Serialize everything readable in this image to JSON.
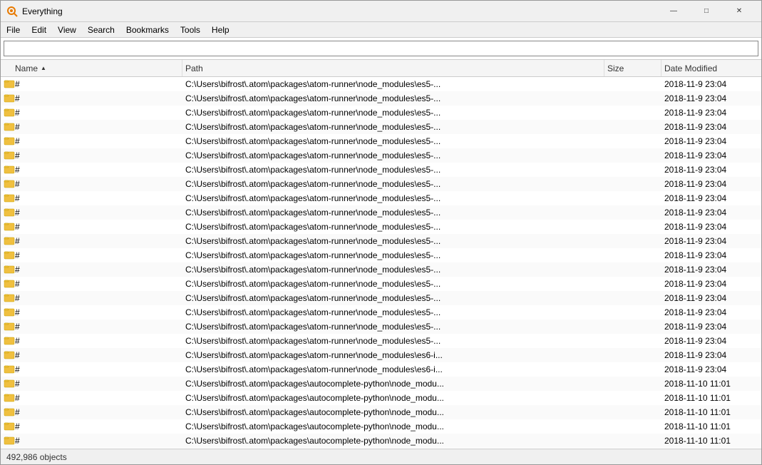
{
  "window": {
    "title": "Everything",
    "icon": "search-icon"
  },
  "titlebar": {
    "minimize_label": "—",
    "maximize_label": "□",
    "close_label": "✕"
  },
  "menubar": {
    "items": [
      {
        "label": "File",
        "id": "file"
      },
      {
        "label": "Edit",
        "id": "edit"
      },
      {
        "label": "View",
        "id": "view"
      },
      {
        "label": "Search",
        "id": "search"
      },
      {
        "label": "Bookmarks",
        "id": "bookmarks"
      },
      {
        "label": "Tools",
        "id": "tools"
      },
      {
        "label": "Help",
        "id": "help"
      }
    ]
  },
  "search": {
    "placeholder": "",
    "value": ""
  },
  "columns": {
    "name": "Name",
    "path": "Path",
    "size": "Size",
    "date_modified": "Date Modified",
    "sort_arrow": "▲"
  },
  "files": [
    {
      "name": "#",
      "path": "C:\\Users\\bifrost\\.atom\\packages\\atom-runner\\node_modules\\es5-...",
      "size": "",
      "date": "2018-11-9 23:04"
    },
    {
      "name": "#",
      "path": "C:\\Users\\bifrost\\.atom\\packages\\atom-runner\\node_modules\\es5-...",
      "size": "",
      "date": "2018-11-9 23:04"
    },
    {
      "name": "#",
      "path": "C:\\Users\\bifrost\\.atom\\packages\\atom-runner\\node_modules\\es5-...",
      "size": "",
      "date": "2018-11-9 23:04"
    },
    {
      "name": "#",
      "path": "C:\\Users\\bifrost\\.atom\\packages\\atom-runner\\node_modules\\es5-...",
      "size": "",
      "date": "2018-11-9 23:04"
    },
    {
      "name": "#",
      "path": "C:\\Users\\bifrost\\.atom\\packages\\atom-runner\\node_modules\\es5-...",
      "size": "",
      "date": "2018-11-9 23:04"
    },
    {
      "name": "#",
      "path": "C:\\Users\\bifrost\\.atom\\packages\\atom-runner\\node_modules\\es5-...",
      "size": "",
      "date": "2018-11-9 23:04"
    },
    {
      "name": "#",
      "path": "C:\\Users\\bifrost\\.atom\\packages\\atom-runner\\node_modules\\es5-...",
      "size": "",
      "date": "2018-11-9 23:04"
    },
    {
      "name": "#",
      "path": "C:\\Users\\bifrost\\.atom\\packages\\atom-runner\\node_modules\\es5-...",
      "size": "",
      "date": "2018-11-9 23:04"
    },
    {
      "name": "#",
      "path": "C:\\Users\\bifrost\\.atom\\packages\\atom-runner\\node_modules\\es5-...",
      "size": "",
      "date": "2018-11-9 23:04"
    },
    {
      "name": "#",
      "path": "C:\\Users\\bifrost\\.atom\\packages\\atom-runner\\node_modules\\es5-...",
      "size": "",
      "date": "2018-11-9 23:04"
    },
    {
      "name": "#",
      "path": "C:\\Users\\bifrost\\.atom\\packages\\atom-runner\\node_modules\\es5-...",
      "size": "",
      "date": "2018-11-9 23:04"
    },
    {
      "name": "#",
      "path": "C:\\Users\\bifrost\\.atom\\packages\\atom-runner\\node_modules\\es5-...",
      "size": "",
      "date": "2018-11-9 23:04"
    },
    {
      "name": "#",
      "path": "C:\\Users\\bifrost\\.atom\\packages\\atom-runner\\node_modules\\es5-...",
      "size": "",
      "date": "2018-11-9 23:04"
    },
    {
      "name": "#",
      "path": "C:\\Users\\bifrost\\.atom\\packages\\atom-runner\\node_modules\\es5-...",
      "size": "",
      "date": "2018-11-9 23:04"
    },
    {
      "name": "#",
      "path": "C:\\Users\\bifrost\\.atom\\packages\\atom-runner\\node_modules\\es5-...",
      "size": "",
      "date": "2018-11-9 23:04"
    },
    {
      "name": "#",
      "path": "C:\\Users\\bifrost\\.atom\\packages\\atom-runner\\node_modules\\es5-...",
      "size": "",
      "date": "2018-11-9 23:04"
    },
    {
      "name": "#",
      "path": "C:\\Users\\bifrost\\.atom\\packages\\atom-runner\\node_modules\\es5-...",
      "size": "",
      "date": "2018-11-9 23:04"
    },
    {
      "name": "#",
      "path": "C:\\Users\\bifrost\\.atom\\packages\\atom-runner\\node_modules\\es5-...",
      "size": "",
      "date": "2018-11-9 23:04"
    },
    {
      "name": "#",
      "path": "C:\\Users\\bifrost\\.atom\\packages\\atom-runner\\node_modules\\es5-...",
      "size": "",
      "date": "2018-11-9 23:04"
    },
    {
      "name": "#",
      "path": "C:\\Users\\bifrost\\.atom\\packages\\atom-runner\\node_modules\\es6-i...",
      "size": "",
      "date": "2018-11-9 23:04"
    },
    {
      "name": "#",
      "path": "C:\\Users\\bifrost\\.atom\\packages\\atom-runner\\node_modules\\es6-i...",
      "size": "",
      "date": "2018-11-9 23:04"
    },
    {
      "name": "#",
      "path": "C:\\Users\\bifrost\\.atom\\packages\\autocomplete-python\\node_modu...",
      "size": "",
      "date": "2018-11-10 11:01"
    },
    {
      "name": "#",
      "path": "C:\\Users\\bifrost\\.atom\\packages\\autocomplete-python\\node_modu...",
      "size": "",
      "date": "2018-11-10 11:01"
    },
    {
      "name": "#",
      "path": "C:\\Users\\bifrost\\.atom\\packages\\autocomplete-python\\node_modu...",
      "size": "",
      "date": "2018-11-10 11:01"
    },
    {
      "name": "#",
      "path": "C:\\Users\\bifrost\\.atom\\packages\\autocomplete-python\\node_modu...",
      "size": "",
      "date": "2018-11-10 11:01"
    },
    {
      "name": "#",
      "path": "C:\\Users\\bifrost\\.atom\\packages\\autocomplete-python\\node_modu...",
      "size": "",
      "date": "2018-11-10 11:01"
    }
  ],
  "statusbar": {
    "count": "492,986 objects"
  }
}
